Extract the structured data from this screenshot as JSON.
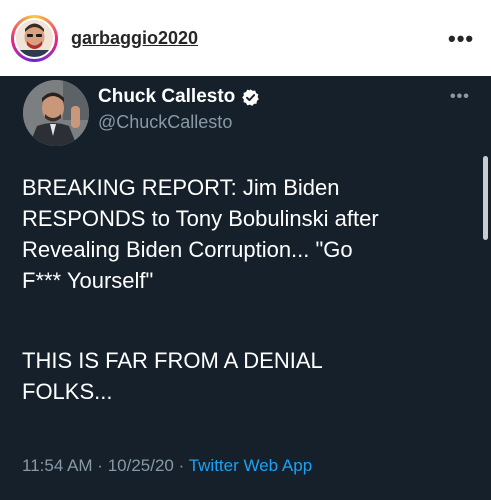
{
  "instagram": {
    "username": "garbaggio2020",
    "more_label": "•••"
  },
  "tweet": {
    "display_name": "Chuck Callesto",
    "handle": "@ChuckCallesto",
    "more_label": "•••",
    "paragraph_1": "BREAKING REPORT: Jim Biden\nRESPONDS to Tony Bobulinski after\nRevealing Biden Corruption... \"Go\nF*** Yourself\"",
    "paragraph_2": "THIS IS FAR FROM A DENIAL\nFOLKS...",
    "time": "11:54 AM",
    "separator_1": " · ",
    "date": "10/25/20",
    "separator_2": " · ",
    "source_app": "Twitter Web App"
  },
  "colors": {
    "tweet_background": "#15202b",
    "secondary_text": "#8899a6",
    "link": "#1da1f2",
    "verified": "#ffffff"
  },
  "icons": [
    "verified-badge-icon",
    "more-options-icon"
  ]
}
